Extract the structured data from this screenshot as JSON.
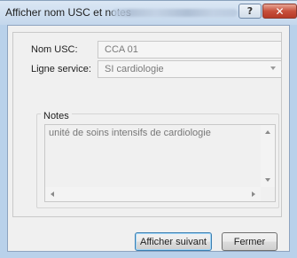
{
  "window": {
    "title": "Afficher nom USC et notes"
  },
  "titlebar": {
    "help_label": "?",
    "close_label": "✕"
  },
  "form": {
    "nom_usc": {
      "label": "Nom USC:",
      "value": "CCA 01"
    },
    "ligne_service": {
      "label": "Ligne service:",
      "value": "SI cardiologie"
    }
  },
  "notes": {
    "title": "Notes",
    "text": "unité de soins intensifs de cardiologie"
  },
  "buttons": {
    "next_label": "Afficher suivant",
    "close_label": "Fermer"
  },
  "icons": {
    "help": "question-icon",
    "close": "close-icon",
    "combo": "chevron-down-icon"
  },
  "colors": {
    "close_button": "#c7503c",
    "default_button_border": "#3c7fb1"
  }
}
